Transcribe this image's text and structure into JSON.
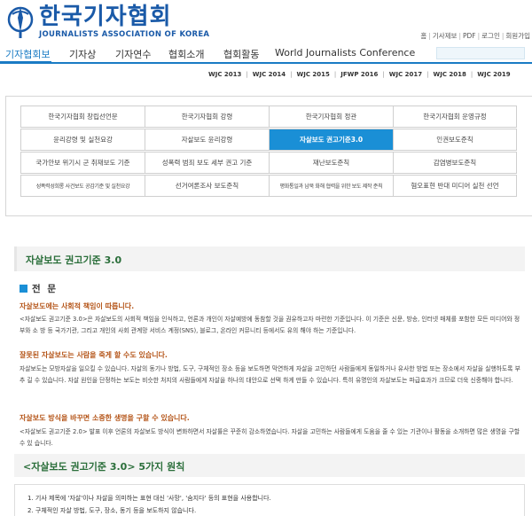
{
  "header": {
    "logo_ko": "한국기자협회",
    "logo_en": "JOURNALISTS ASSOCIATION OF KOREA",
    "util_links": [
      "홈",
      "기사제보",
      "PDF",
      "로그인",
      "회원가입"
    ]
  },
  "nav": {
    "items": [
      "기자협회보",
      "기자상",
      "기자연수",
      "협회소개",
      "협회활동",
      "World Journalists Conference"
    ]
  },
  "subnav": {
    "items": [
      "WJC 2013",
      "WJC 2014",
      "WJC 2015",
      "JFWP 2016",
      "WJC 2017",
      "WJC 2018",
      "WJC 2019"
    ]
  },
  "grid": {
    "rows": [
      [
        "한국기자협회 창립선언문",
        "한국기자협회 강령",
        "한국기자협회 정관",
        "한국기자협회 운영규정"
      ],
      [
        "윤리강령 및 실천요강",
        "자살보도 윤리강령",
        "자살보도 권고기준3.0",
        "인권보도준칙"
      ],
      [
        "국가안보 위기시 군 취재보도 기준",
        "성폭력 범죄 보도 세부 권고 기준",
        "재난보도준칙",
        "감염병보도준칙"
      ],
      [
        "성폭력성희롱 사건보도 공감기준 및 실천요강",
        "선거여론조사 보도준칙",
        "평화통일과 남북 화해 협력을 위한 보도 제작 준칙",
        "혐오표현 반대 미디어 실천 선언"
      ]
    ],
    "active": "자살보도 권고기준3.0"
  },
  "content": {
    "title": "자살보도 권고기준 3.0",
    "section_head": "전 문",
    "sub1": "자살보도에는 사회적 책임이 따릅니다.",
    "para1": "<자살보도 권고기준 3.0>은 자살보도의 사회적 책임을 인식하고, 언론과 개인이 자살예방에 동참할 것을 권유하고자 마련한 기준입니다. 이 기준은 신문, 방송, 인터넷 매체를 포함한 모든 미디어와 정부와 소 방 등 국가기관, 그리고 개인의 사회 관계망 서비스 계정(SNS), 블로그, 온라인 커뮤니티 등에서도 유의 해야 하는 기준입니다.",
    "sub2": "잘못된 자살보도는 사람을 죽게 할 수도 있습니다.",
    "para2": "자살보도는 모방자살을 일으킬 수 있습니다. 자살의 동기나 방법, 도구, 구체적인 장소 등을 보도하면 막연하게 자살을 고민하던 사람들에게 동일하거나 유사한 방법 또는 장소에서 자살을 실행하도록 부추 길 수 있습니다. 자살 원인을 단정하는 보도는 비슷한 처지의 사람들에게 자살을 하나의 대안으로 선택 하게 만들 수 있습니다. 특히 유명인의 자살보도는 파급효과가 크므로 더욱 신중해야 합니다.",
    "sub3": "자살보도 방식을 바꾸면 소중한 생명을 구할 수 있습니다.",
    "para3": "<자살보도 권고기준 2.0> 발표 이후 언론의 자살보도 방식이 변화하면서 자살률은 꾸준히 감소하였습니다. 자살을 고민하는 사람들에게 도움을 줄 수 있는 기관이나 활동을 소개하면 많은 생명을 구할 수 있 습니다.",
    "principles_title": "<자살보도 권고기준 3.0> 5가지 원칙",
    "list": [
      "1. 기사 제목에 '자살'이나 자살을 의미하는 표현 대신 '사망', '숨지다' 등의 표현을 사용합니다.",
      "2. 구체적인 자살 방법, 도구, 장소, 동기 등을 보도하지 않습니다."
    ]
  },
  "colors": {
    "brand_blue": "#1a5aa8",
    "accent_blue": "#1a8fd6",
    "title_green": "#2a6e3a",
    "sub_orange": "#b5561a"
  }
}
